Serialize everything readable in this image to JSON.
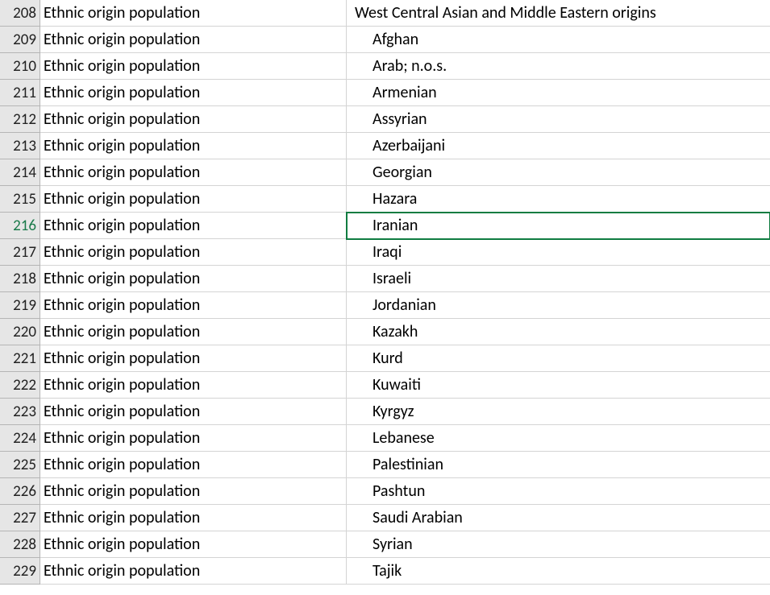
{
  "selectedRowIndex": 8,
  "colors": {
    "accent": "#107c41"
  },
  "chart_data": {
    "type": "table",
    "title": "",
    "columns": [
      "Row",
      "Category",
      "Value"
    ],
    "rows": [
      [
        208,
        "Ethnic origin population",
        "West Central Asian and Middle Eastern origins"
      ],
      [
        209,
        "Ethnic origin population",
        "Afghan"
      ],
      [
        210,
        "Ethnic origin population",
        "Arab; n.o.s."
      ],
      [
        211,
        "Ethnic origin population",
        "Armenian"
      ],
      [
        212,
        "Ethnic origin population",
        "Assyrian"
      ],
      [
        213,
        "Ethnic origin population",
        "Azerbaijani"
      ],
      [
        214,
        "Ethnic origin population",
        "Georgian"
      ],
      [
        215,
        "Ethnic origin population",
        "Hazara"
      ],
      [
        216,
        "Ethnic origin population",
        "Iranian"
      ],
      [
        217,
        "Ethnic origin population",
        "Iraqi"
      ],
      [
        218,
        "Ethnic origin population",
        "Israeli"
      ],
      [
        219,
        "Ethnic origin population",
        "Jordanian"
      ],
      [
        220,
        "Ethnic origin population",
        "Kazakh"
      ],
      [
        221,
        "Ethnic origin population",
        "Kurd"
      ],
      [
        222,
        "Ethnic origin population",
        "Kuwaiti"
      ],
      [
        223,
        "Ethnic origin population",
        "Kyrgyz"
      ],
      [
        224,
        "Ethnic origin population",
        "Lebanese"
      ],
      [
        225,
        "Ethnic origin population",
        "Palestinian"
      ],
      [
        226,
        "Ethnic origin population",
        "Pashtun"
      ],
      [
        227,
        "Ethnic origin population",
        "Saudi Arabian"
      ],
      [
        228,
        "Ethnic origin population",
        "Syrian"
      ],
      [
        229,
        "Ethnic origin population",
        "Tajik"
      ]
    ]
  },
  "rows": [
    {
      "num": "208",
      "cat": "Ethnic origin population",
      "val": "West Central Asian and Middle Eastern origins",
      "indent": false
    },
    {
      "num": "209",
      "cat": "Ethnic origin population",
      "val": "Afghan",
      "indent": true
    },
    {
      "num": "210",
      "cat": "Ethnic origin population",
      "val": "Arab; n.o.s.",
      "indent": true
    },
    {
      "num": "211",
      "cat": "Ethnic origin population",
      "val": "Armenian",
      "indent": true
    },
    {
      "num": "212",
      "cat": "Ethnic origin population",
      "val": "Assyrian",
      "indent": true
    },
    {
      "num": "213",
      "cat": "Ethnic origin population",
      "val": "Azerbaijani",
      "indent": true
    },
    {
      "num": "214",
      "cat": "Ethnic origin population",
      "val": "Georgian",
      "indent": true
    },
    {
      "num": "215",
      "cat": "Ethnic origin population",
      "val": "Hazara",
      "indent": true
    },
    {
      "num": "216",
      "cat": "Ethnic origin population",
      "val": "Iranian",
      "indent": true
    },
    {
      "num": "217",
      "cat": "Ethnic origin population",
      "val": "Iraqi",
      "indent": true
    },
    {
      "num": "218",
      "cat": "Ethnic origin population",
      "val": "Israeli",
      "indent": true
    },
    {
      "num": "219",
      "cat": "Ethnic origin population",
      "val": "Jordanian",
      "indent": true
    },
    {
      "num": "220",
      "cat": "Ethnic origin population",
      "val": "Kazakh",
      "indent": true
    },
    {
      "num": "221",
      "cat": "Ethnic origin population",
      "val": "Kurd",
      "indent": true
    },
    {
      "num": "222",
      "cat": "Ethnic origin population",
      "val": "Kuwaiti",
      "indent": true
    },
    {
      "num": "223",
      "cat": "Ethnic origin population",
      "val": "Kyrgyz",
      "indent": true
    },
    {
      "num": "224",
      "cat": "Ethnic origin population",
      "val": "Lebanese",
      "indent": true
    },
    {
      "num": "225",
      "cat": "Ethnic origin population",
      "val": "Palestinian",
      "indent": true
    },
    {
      "num": "226",
      "cat": "Ethnic origin population",
      "val": "Pashtun",
      "indent": true
    },
    {
      "num": "227",
      "cat": "Ethnic origin population",
      "val": "Saudi Arabian",
      "indent": true
    },
    {
      "num": "228",
      "cat": "Ethnic origin population",
      "val": "Syrian",
      "indent": true
    },
    {
      "num": "229",
      "cat": "Ethnic origin population",
      "val": "Tajik",
      "indent": true
    }
  ]
}
